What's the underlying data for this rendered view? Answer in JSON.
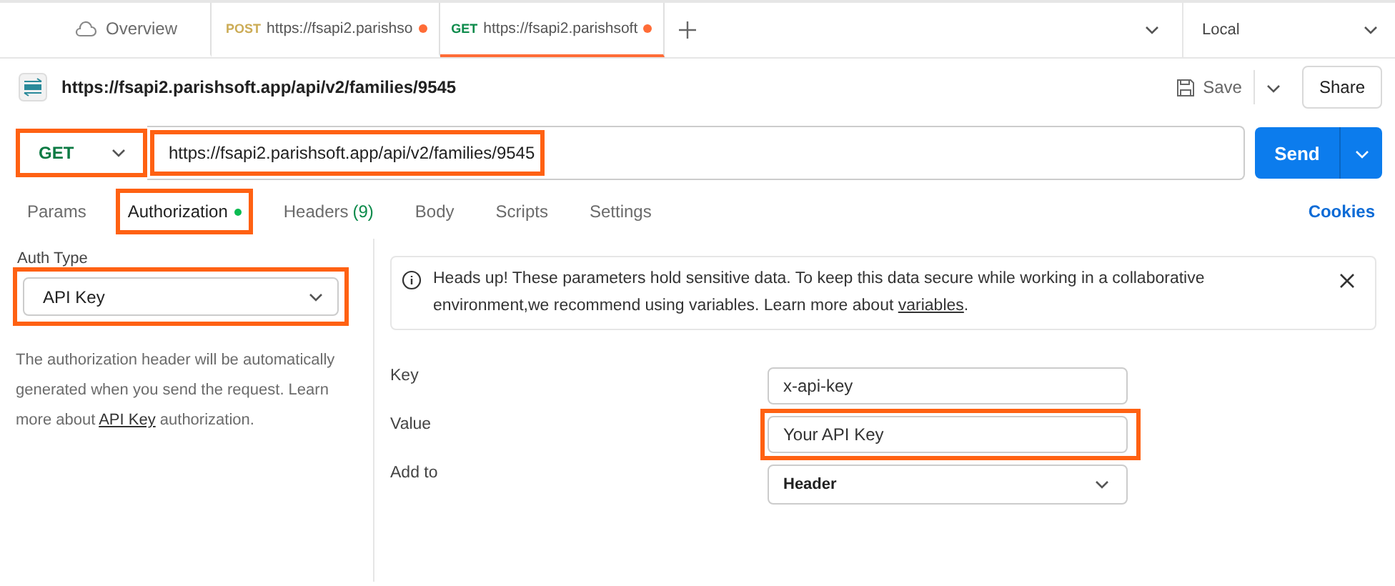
{
  "tabs": [
    {
      "kind": "overview",
      "label": "Overview",
      "selected": false
    },
    {
      "kind": "request",
      "method": "POST",
      "label": "https://fsapi2.parishso",
      "unsaved": true,
      "selected": false
    },
    {
      "kind": "request",
      "method": "GET",
      "label": "https://fsapi2.parishsoft",
      "unsaved": true,
      "selected": true
    }
  ],
  "environment": "Local",
  "request_name": "https://fsapi2.parishsoft.app/api/v2/families/9545",
  "save_label": "Save",
  "share_label": "Share",
  "method": {
    "value": "GET",
    "highlighted": true
  },
  "url": {
    "value": "https://fsapi2.parishsoft.app/api/v2/families/9545",
    "highlighted": true
  },
  "send_label": "Send",
  "request_tabs": [
    {
      "label": "Params",
      "selected": false,
      "highlighted": false,
      "dot": false
    },
    {
      "label": "Authorization",
      "selected": true,
      "highlighted": true,
      "dot": true
    },
    {
      "label": "Headers",
      "count": "(9)",
      "selected": false,
      "highlighted": false,
      "dot": false
    },
    {
      "label": "Body",
      "selected": false,
      "highlighted": false,
      "dot": false
    },
    {
      "label": "Scripts",
      "selected": false,
      "highlighted": false,
      "dot": false
    },
    {
      "label": "Settings",
      "selected": false,
      "highlighted": false,
      "dot": false
    }
  ],
  "cookies_label": "Cookies",
  "auth_type": {
    "label": "Auth Type",
    "value": "API Key",
    "highlighted": true
  },
  "auth_help": {
    "before": "The authorization header will be automatically generated when you send the request. Learn more about",
    "link": "API Key",
    "after": "authorization."
  },
  "notice": {
    "before": "Heads up! These parameters hold sensitive data. To keep this data secure while working in a collaborative environment,we recommend using variables. Learn more about",
    "link": "variables",
    "after": "."
  },
  "fields": [
    {
      "kind": "input",
      "label": "Key",
      "value": "x-api-key",
      "highlighted": false
    },
    {
      "kind": "input",
      "label": "Value",
      "value": "Your API Key",
      "highlighted": true
    },
    {
      "kind": "select",
      "label": "Add to",
      "value": "Header",
      "highlighted": false
    }
  ]
}
